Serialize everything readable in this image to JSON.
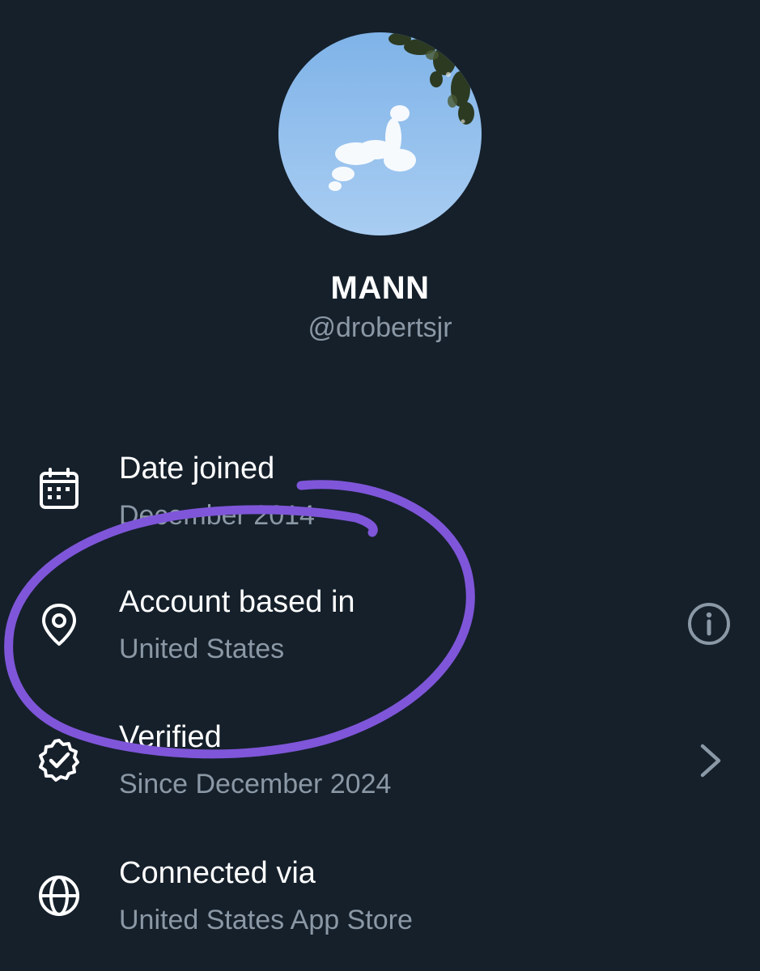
{
  "profile": {
    "display_name": "MANN",
    "handle": "@drobertsjr"
  },
  "rows": [
    {
      "title": "Date joined",
      "subtitle": "December 2014",
      "icon": "calendar-icon"
    },
    {
      "title": "Account based in",
      "subtitle": "United States",
      "icon": "location-pin-icon",
      "action": "info-icon"
    },
    {
      "title": "Verified",
      "subtitle": "Since December 2024",
      "icon": "verified-badge-icon",
      "action": "chevron-right-icon"
    },
    {
      "title": "Connected via",
      "subtitle": "United States App Store",
      "icon": "globe-icon"
    }
  ],
  "colors": {
    "background": "#15202b",
    "primary_text": "#ffffff",
    "secondary_text": "#8b98a5",
    "annotation_stroke": "#7f56d9"
  }
}
